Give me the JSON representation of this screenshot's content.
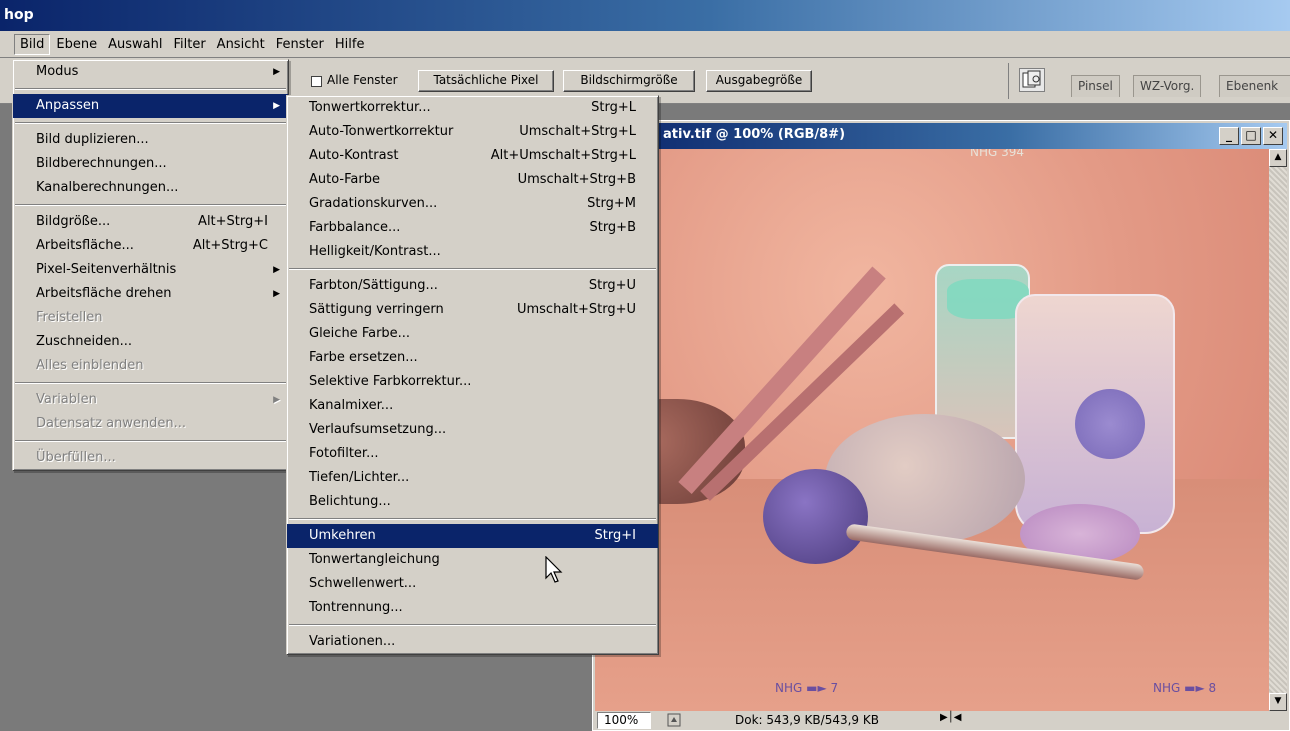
{
  "app": {
    "title": "hop"
  },
  "menubar": [
    "Bild",
    "Ebene",
    "Auswahl",
    "Filter",
    "Ansicht",
    "Fenster",
    "Hilfe"
  ],
  "options_bar": {
    "all_windows_label": "Alle Fenster",
    "all_windows_checked": false,
    "buttons": [
      "Tatsächliche Pixel",
      "Bildschirmgröße",
      "Ausgabegröße"
    ],
    "palette_tabs": [
      "Pinsel",
      "WZ-Vorg.",
      "Ebenenk"
    ]
  },
  "document": {
    "title": "ativ.tif @ 100% (RGB/8#)",
    "zoom": "100%",
    "doc_info": "Dok: 543,9 KB/543,9 KB",
    "edge_labels": {
      "top": "NHG 394",
      "bottom_left": "NHG ▬► 7",
      "bottom_right": "NHG ▬► 8"
    }
  },
  "bild_menu": [
    {
      "label": "Modus",
      "submenu": true
    },
    {
      "sep": true
    },
    {
      "label": "Anpassen",
      "submenu": true,
      "highlighted": true
    },
    {
      "sep": true
    },
    {
      "label": "Bild duplizieren..."
    },
    {
      "label": "Bildberechnungen..."
    },
    {
      "label": "Kanalberechnungen..."
    },
    {
      "sep": true
    },
    {
      "label": "Bildgröße...",
      "shortcut": "Alt+Strg+I"
    },
    {
      "label": "Arbeitsfläche...",
      "shortcut": "Alt+Strg+C"
    },
    {
      "label": "Pixel-Seitenverhältnis",
      "submenu": true
    },
    {
      "label": "Arbeitsfläche drehen",
      "submenu": true
    },
    {
      "label": "Freistellen",
      "disabled": true
    },
    {
      "label": "Zuschneiden..."
    },
    {
      "label": "Alles einblenden",
      "disabled": true
    },
    {
      "sep": true
    },
    {
      "label": "Variablen",
      "submenu": true,
      "disabled": true
    },
    {
      "label": "Datensatz anwenden...",
      "disabled": true
    },
    {
      "sep": true
    },
    {
      "label": "Überfüllen...",
      "disabled": true
    }
  ],
  "anpassen_menu": [
    {
      "label": "Tonwertkorrektur...",
      "shortcut": "Strg+L"
    },
    {
      "label": "Auto-Tonwertkorrektur",
      "shortcut": "Umschalt+Strg+L"
    },
    {
      "label": "Auto-Kontrast",
      "shortcut": "Alt+Umschalt+Strg+L"
    },
    {
      "label": "Auto-Farbe",
      "shortcut": "Umschalt+Strg+B"
    },
    {
      "label": "Gradationskurven...",
      "shortcut": "Strg+M"
    },
    {
      "label": "Farbbalance...",
      "shortcut": "Strg+B"
    },
    {
      "label": "Helligkeit/Kontrast..."
    },
    {
      "sep": true
    },
    {
      "label": "Farbton/Sättigung...",
      "shortcut": "Strg+U"
    },
    {
      "label": "Sättigung verringern",
      "shortcut": "Umschalt+Strg+U"
    },
    {
      "label": "Gleiche Farbe..."
    },
    {
      "label": "Farbe ersetzen..."
    },
    {
      "label": "Selektive Farbkorrektur..."
    },
    {
      "label": "Kanalmixer..."
    },
    {
      "label": "Verlaufsumsetzung..."
    },
    {
      "label": "Fotofilter..."
    },
    {
      "label": "Tiefen/Lichter..."
    },
    {
      "label": "Belichtung..."
    },
    {
      "sep": true
    },
    {
      "label": "Umkehren",
      "shortcut": "Strg+I",
      "highlighted": true
    },
    {
      "label": "Tonwertangleichung"
    },
    {
      "label": "Schwellenwert..."
    },
    {
      "label": "Tontrennung..."
    },
    {
      "sep": true
    },
    {
      "label": "Variationen..."
    }
  ]
}
